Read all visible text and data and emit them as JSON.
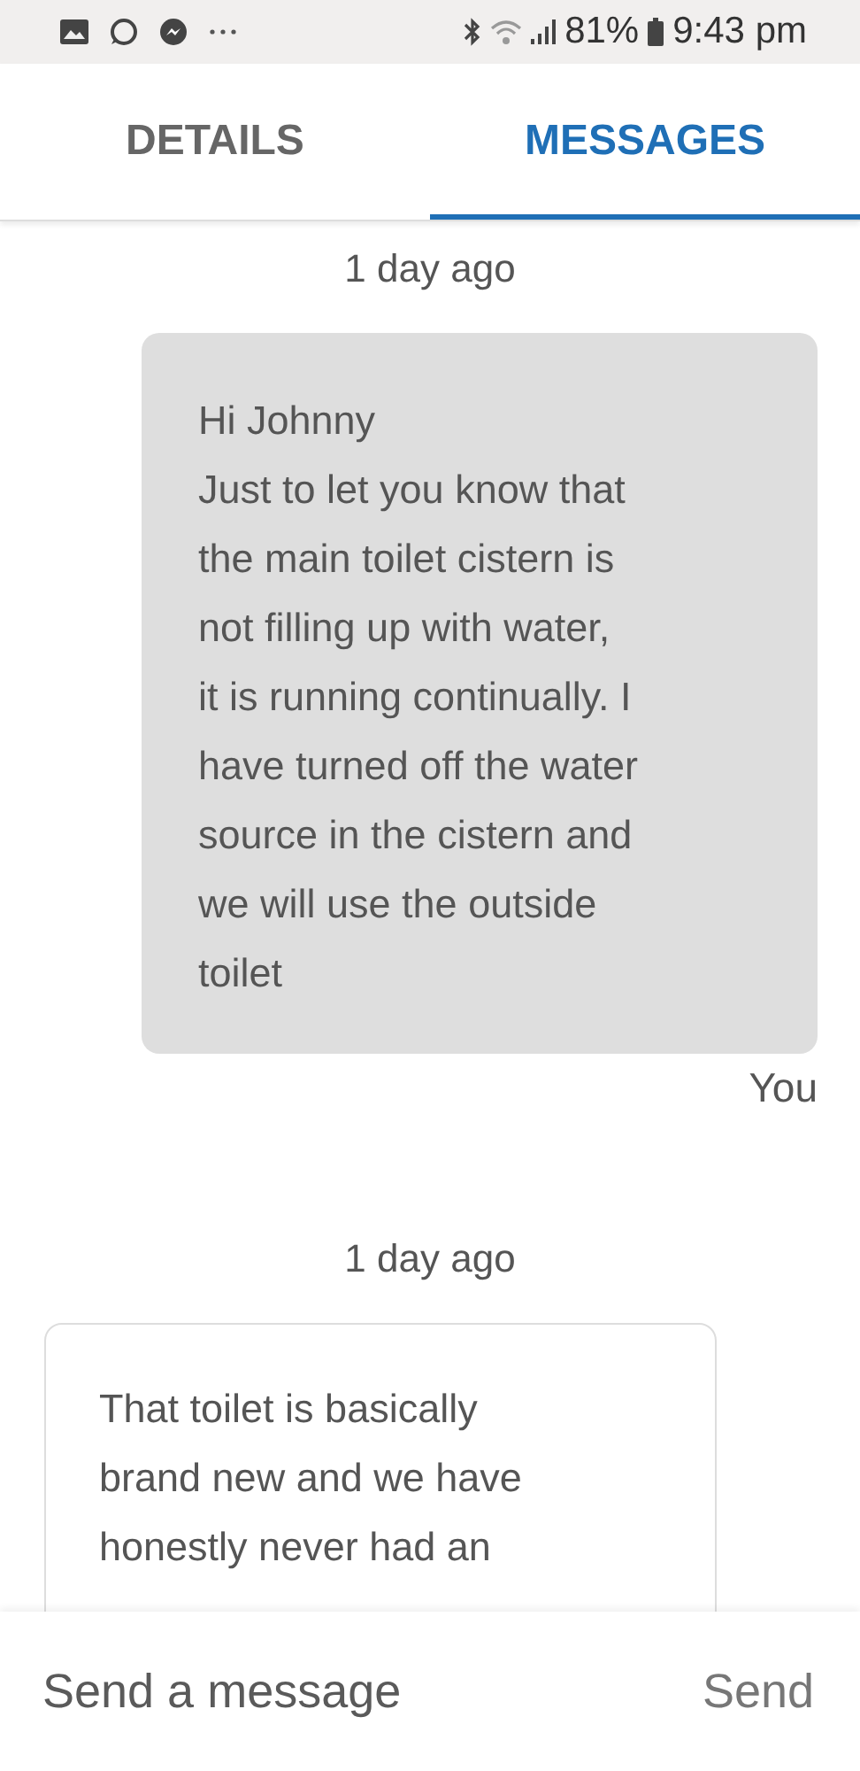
{
  "status_bar": {
    "battery": "81%",
    "time": "9:43 pm"
  },
  "tabs": [
    {
      "label": "DETAILS",
      "selected": false
    },
    {
      "label": "MESSAGES",
      "selected": true
    }
  ],
  "messages": [
    {
      "timestamp": "1 day ago",
      "kind": "sent",
      "text": "Hi Johnny\nJust to let you know that\nthe main toilet cistern is\nnot filling up with water,\nit is running continually. I\nhave turned off the water\nsource in the cistern and\nwe will use the outside\ntoilet",
      "sender": "You"
    },
    {
      "timestamp": "1 day ago",
      "kind": "received",
      "text": "That toilet is basically\nbrand new and we have\nhonestly never had an"
    }
  ],
  "composer": {
    "placeholder": "Send a message",
    "button": "Send"
  }
}
